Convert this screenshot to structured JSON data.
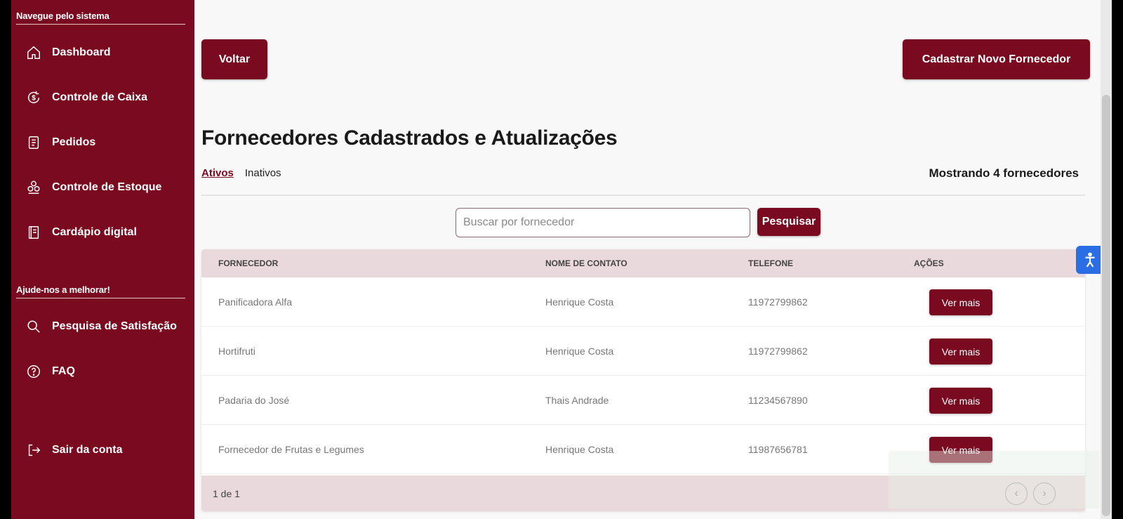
{
  "sidebar": {
    "section1_title": "Navegue pelo sistema",
    "section2_title": "Ajude-nos a melhorar!",
    "items": [
      {
        "label": "Dashboard",
        "icon": "home-icon"
      },
      {
        "label": "Controle de Caixa",
        "icon": "money-cycle-icon"
      },
      {
        "label": "Pedidos",
        "icon": "receipt-icon"
      },
      {
        "label": "Controle de Estoque",
        "icon": "boxes-icon"
      },
      {
        "label": "Cardápio digital",
        "icon": "menu-book-icon"
      }
    ],
    "help_items": [
      {
        "label": "Pesquisa de Satisfação",
        "icon": "search-icon"
      },
      {
        "label": "FAQ",
        "icon": "question-icon"
      }
    ],
    "logout": {
      "label": "Sair da conta",
      "icon": "logout-icon"
    }
  },
  "header": {
    "back_label": "Voltar",
    "new_supplier_label": "Cadastrar Novo Fornecedor"
  },
  "page": {
    "title": "Fornecedores Cadastrados e Atualizações",
    "tabs": [
      {
        "label": "Ativos",
        "active": true
      },
      {
        "label": "Inativos",
        "active": false
      }
    ],
    "count_text": "Mostrando 4 fornecedores"
  },
  "search": {
    "placeholder": "Buscar por fornecedor",
    "value": "",
    "button_label": "Pesquisar"
  },
  "table": {
    "headers": [
      "FORNECEDOR",
      "NOME DE CONTATO",
      "TELEFONE",
      "AÇÕES"
    ],
    "rows": [
      {
        "supplier": "Panificadora Alfa",
        "contact": "Henrique Costa",
        "phone": "11972799862",
        "action": "Ver mais"
      },
      {
        "supplier": "Hortifruti",
        "contact": "Henrique Costa",
        "phone": "11972799862",
        "action": "Ver mais"
      },
      {
        "supplier": "Padaria do José",
        "contact": "Thais Andrade",
        "phone": "11234567890",
        "action": "Ver mais"
      },
      {
        "supplier": "Fornecedor de Frutas e Legumes",
        "contact": "Henrique Costa",
        "phone": "11987656781",
        "action": "Ver mais"
      }
    ],
    "pagination": "1 de 1"
  },
  "colors": {
    "brand": "#7a0a1f",
    "table_header_bg": "#ead9dc",
    "accessibility": "#2a6ee6"
  }
}
